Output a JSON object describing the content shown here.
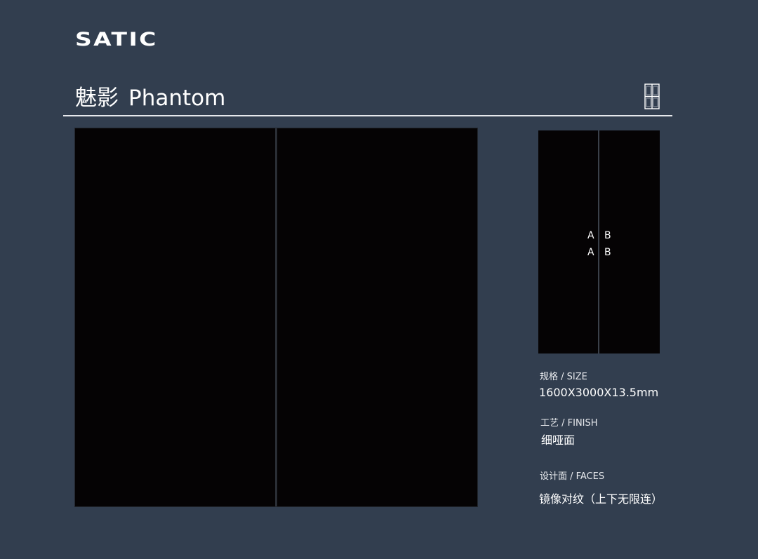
{
  "brand": {
    "logo_text": "SATIC"
  },
  "header": {
    "title_zh": "魅影",
    "title_en": "Phantom",
    "pattern_icon": "tile-layout-icon"
  },
  "preview": {
    "large_tile_color": "#050304",
    "small_tile": {
      "marks": [
        "A",
        "B",
        "A",
        "B"
      ]
    }
  },
  "specs": {
    "size": {
      "label": "规格 / SIZE",
      "value": "1600X3000X13.5mm"
    },
    "finish": {
      "label": "工艺 / FINISH",
      "value": "细哑面"
    },
    "faces": {
      "label": "设计面 / FACES",
      "value": "镜像对纹（上下无限连）"
    }
  },
  "colors": {
    "background": "#323e4f",
    "tile": "#050304",
    "text": "#ffffff"
  }
}
